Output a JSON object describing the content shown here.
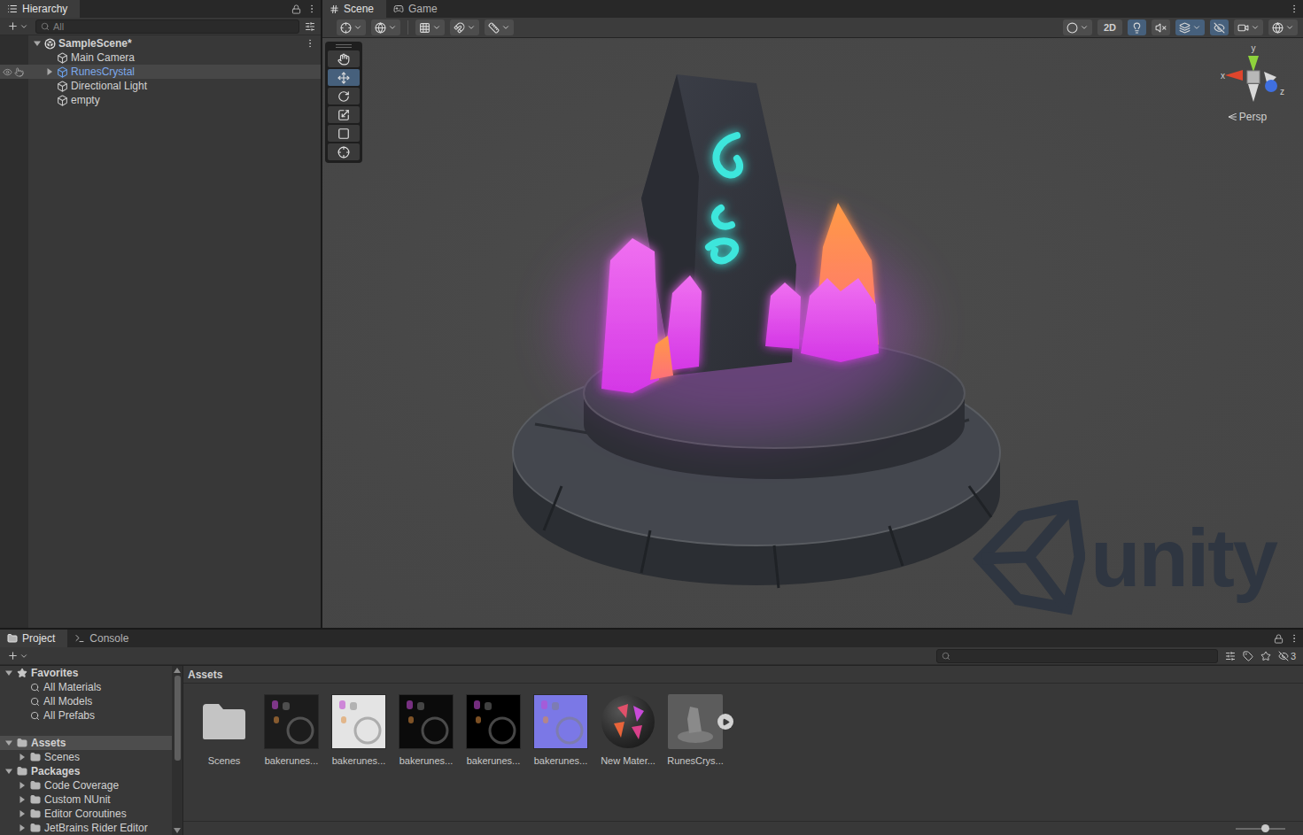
{
  "hierarchy": {
    "title": "Hierarchy",
    "search": {
      "placeholder": "All"
    },
    "scene": {
      "name": "SampleScene*",
      "expanded": true
    },
    "items": [
      {
        "name": "Main Camera",
        "selected": false,
        "has_children": false,
        "expanded": false,
        "prefab": false
      },
      {
        "name": "RunesCrystal",
        "selected": true,
        "has_children": true,
        "expanded": false,
        "prefab": true
      },
      {
        "name": "Directional Light",
        "selected": false,
        "has_children": false,
        "expanded": false,
        "prefab": false
      },
      {
        "name": "empty",
        "selected": false,
        "has_children": false,
        "expanded": false,
        "prefab": false
      }
    ]
  },
  "scene_view": {
    "tabs": [
      {
        "label": "Scene",
        "selected": true
      },
      {
        "label": "Game",
        "selected": false
      }
    ],
    "toolbar": {
      "two_d": {
        "label": "2D",
        "on": false
      },
      "toggles": [
        {
          "name": "lighting",
          "on": true
        },
        {
          "name": "audio",
          "on": false
        },
        {
          "name": "effects",
          "on": true
        },
        {
          "name": "visibility",
          "on": true
        }
      ]
    },
    "tools": [
      {
        "name": "hand",
        "selected": false
      },
      {
        "name": "move",
        "selected": true
      },
      {
        "name": "rotate",
        "selected": false
      },
      {
        "name": "scale",
        "selected": false
      },
      {
        "name": "rect",
        "selected": false
      },
      {
        "name": "transform",
        "selected": false
      }
    ],
    "gizmo": {
      "x": "x",
      "y": "y",
      "z": "z",
      "projection": "Persp"
    },
    "watermark": "unity"
  },
  "project": {
    "tabs": [
      {
        "label": "Project",
        "selected": true
      },
      {
        "label": "Console",
        "selected": false
      }
    ],
    "hidden_count": "3",
    "tree": [
      [
        {
          "label": "Favorites",
          "kind": "favorites",
          "indent": 0,
          "expandable": true,
          "expanded": true,
          "selected": false
        },
        {
          "label": "All Materials",
          "kind": "search",
          "indent": 1,
          "expandable": false,
          "expanded": false,
          "selected": false
        },
        {
          "label": "All Models",
          "kind": "search",
          "indent": 1,
          "expandable": false,
          "expanded": false,
          "selected": false
        },
        {
          "label": "All Prefabs",
          "kind": "search",
          "indent": 1,
          "expandable": false,
          "expanded": false,
          "selected": false
        }
      ],
      [
        {
          "label": "Assets",
          "kind": "group",
          "indent": 0,
          "expandable": true,
          "expanded": true,
          "selected": true
        },
        {
          "label": "Scenes",
          "kind": "folder",
          "indent": 1,
          "expandable": true,
          "expanded": false,
          "selected": false
        },
        {
          "label": "Packages",
          "kind": "group",
          "indent": 0,
          "expandable": true,
          "expanded": true,
          "selected": false
        },
        {
          "label": "Code Coverage",
          "kind": "folder",
          "indent": 1,
          "expandable": true,
          "expanded": false,
          "selected": false
        },
        {
          "label": "Custom NUnit",
          "kind": "folder",
          "indent": 1,
          "expandable": true,
          "expanded": false,
          "selected": false
        },
        {
          "label": "Editor Coroutines",
          "kind": "folder",
          "indent": 1,
          "expandable": true,
          "expanded": false,
          "selected": false
        },
        {
          "label": "JetBrains Rider Editor",
          "kind": "folder",
          "indent": 1,
          "expandable": true,
          "expanded": false,
          "selected": false
        }
      ]
    ],
    "breadcrumb": "Assets",
    "assets": [
      {
        "label": "Scenes",
        "kind": "folder",
        "color": "#c4c4c4"
      },
      {
        "label": "bakerunes...",
        "kind": "texture",
        "color": "#1c1c1c"
      },
      {
        "label": "bakerunes...",
        "kind": "texture",
        "color": "#e4e4e4"
      },
      {
        "label": "bakerunes...",
        "kind": "texture",
        "color": "#0b0b0b"
      },
      {
        "label": "bakerunes...",
        "kind": "texture",
        "color": "#000000"
      },
      {
        "label": "bakerunes...",
        "kind": "texture",
        "color": "#7b78e6"
      },
      {
        "label": "New Mater...",
        "kind": "material",
        "color": "#2a2a2a"
      },
      {
        "label": "RunesCrys...",
        "kind": "model",
        "color": "#5c5c5c"
      }
    ]
  }
}
